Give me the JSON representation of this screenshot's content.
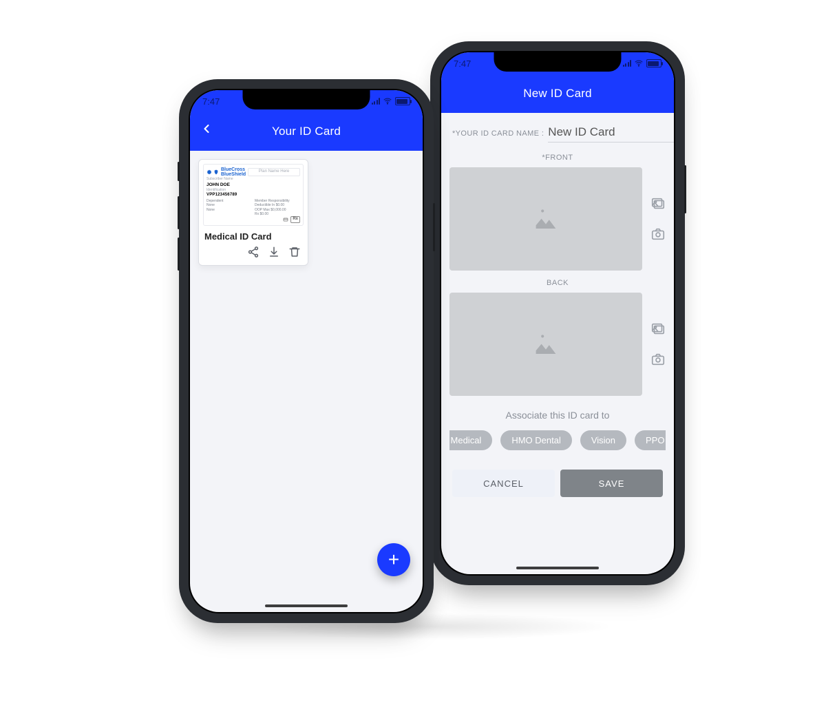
{
  "status": {
    "time": "7:47"
  },
  "left": {
    "title": "Your ID Card",
    "tile": {
      "brand": "BlueCross\nBlueShield",
      "plan_placeholder": "Plan Name Here",
      "subscriber_label": "Subscriber Name",
      "subscriber_name": "JOHN DOE",
      "id_label": "Identification",
      "id_number": "VPP123456789",
      "rx": "Rx",
      "card_title": "Medical ID Card"
    }
  },
  "right": {
    "title": "New ID Card",
    "card_name_label": "*YOUR ID CARD NAME :",
    "card_name_value": "New ID Card",
    "front_label": "*FRONT",
    "back_label": "BACK",
    "associate_label": "Associate this ID card to",
    "chips": [
      "Medical",
      "HMO Dental",
      "Vision",
      "PPO"
    ],
    "cancel": "CANCEL",
    "save": "SAVE"
  }
}
